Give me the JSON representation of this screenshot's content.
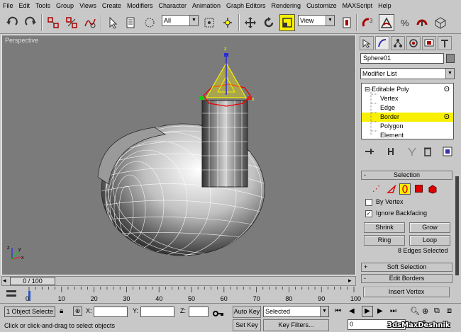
{
  "menubar": [
    "File",
    "Edit",
    "Tools",
    "Group",
    "Views",
    "Create",
    "Modifiers",
    "Character",
    "Animation",
    "Graph Editors",
    "Rendering",
    "Customize",
    "MAXScript",
    "Help"
  ],
  "toolbar": {
    "selection_filter": "All",
    "ref_coord": "View"
  },
  "viewport": {
    "label": "Perspective",
    "axis": {
      "x": "x",
      "y": "y",
      "z": "z"
    }
  },
  "panel": {
    "object_name": "Sphere01",
    "modifier_list": "Modifier List",
    "stack": [
      {
        "label": "Editable Poly",
        "level": 0,
        "expand": "⊟"
      },
      {
        "label": "Vertex",
        "level": 1
      },
      {
        "label": "Edge",
        "level": 1
      },
      {
        "label": "Border",
        "level": 1,
        "selected": true
      },
      {
        "label": "Polygon",
        "level": 1
      },
      {
        "label": "Element",
        "level": 1
      }
    ],
    "selection_rollout": {
      "title": "Selection",
      "by_vertex": {
        "label": "By Vertex",
        "checked": false
      },
      "ignore_backfacing": {
        "label": "Ignore Backfacing",
        "checked": true
      },
      "shrink": "Shrink",
      "grow": "Grow",
      "ring": "Ring",
      "loop": "Loop",
      "status": "8 Edges Selected"
    },
    "soft_selection": "Soft Selection",
    "edit_borders": "Edit Borders",
    "insert_vertex": "Insert Vertex",
    "rollout_pm": "+",
    "rollout_pm_open": "-"
  },
  "timeline": {
    "frame": "0 / 100",
    "ticks": [
      "0",
      "10",
      "20",
      "30",
      "40",
      "50",
      "60",
      "70",
      "80",
      "90",
      "100"
    ]
  },
  "status": {
    "selected": "1 Object Selecte",
    "x_label": "X:",
    "y_label": "Y:",
    "z_label": "Z:",
    "auto_key": "Auto Key",
    "set_key": "Set Key",
    "key_mode": "Selected",
    "key_filters": "Key Filters...",
    "prompt": "Click or click-and-drag to select objects",
    "frame_field": "0",
    "watermark": "3dsMaxDeshnik"
  },
  "colors": {
    "highlight": "#f8f000",
    "viewport": "#7b7b7b"
  }
}
